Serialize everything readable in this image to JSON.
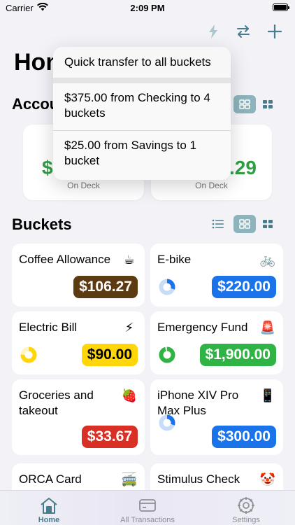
{
  "status": {
    "carrier": "Carrier",
    "time": "2:09 PM"
  },
  "header": {
    "title": "Home"
  },
  "accounts": {
    "title": "Accounts",
    "cards": [
      {
        "amount_visible": "$",
        "caption": "On Deck"
      },
      {
        "amount_visible": ".29",
        "caption": "On Deck"
      }
    ]
  },
  "buckets": {
    "title": "Buckets",
    "items": [
      {
        "name": "Coffee Allowance",
        "icon": "coffee-icon",
        "glyph": "☕",
        "amount": "$106.27",
        "color": "#5c3a12",
        "text_color": "#ffffff",
        "gauge": null
      },
      {
        "name": "E-bike",
        "icon": "bicycle-icon",
        "glyph": "🚲",
        "amount": "$220.00",
        "color": "#1a73e8",
        "text_color": "#ffffff",
        "gauge": 0.3
      },
      {
        "name": "Electric Bill",
        "icon": "lightning-icon",
        "glyph": "⚡",
        "amount": "$90.00",
        "color": "#ffd60a",
        "text_color": "#000000",
        "gauge": 0.75
      },
      {
        "name": "Emergency Fund",
        "icon": "siren-icon",
        "glyph": "🚨",
        "amount": "$1,900.00",
        "color": "#2fb344",
        "text_color": "#ffffff",
        "gauge": 0.95
      },
      {
        "name": "Groceries and takeout",
        "icon": "strawberry-icon",
        "glyph": "🍓",
        "amount": "$33.67",
        "color": "#d93025",
        "text_color": "#ffffff",
        "gauge": null
      },
      {
        "name": "iPhone XIV Pro Max Plus",
        "icon": "phone-icon",
        "glyph": "📱",
        "amount": "$300.00",
        "color": "#1a73e8",
        "text_color": "#ffffff",
        "gauge": 0.3
      },
      {
        "name": "ORCA Card",
        "icon": "trolleybus-icon",
        "glyph": "🚎",
        "amount": "",
        "color": "",
        "text_color": "",
        "gauge": null
      },
      {
        "name": "Stimulus Check",
        "icon": "clown-icon",
        "glyph": "🤡",
        "amount": "",
        "color": "",
        "text_color": "",
        "gauge": null
      }
    ]
  },
  "menu": {
    "header": "Quick transfer to all buckets",
    "items": [
      {
        "label": "$375.00 from Checking to 4 buckets"
      },
      {
        "label": "$25.00 from Savings to 1 bucket"
      }
    ]
  },
  "tabs": [
    {
      "label": "Home",
      "icon": "house-icon"
    },
    {
      "label": "All Transactions",
      "icon": "credit-card-icon"
    },
    {
      "label": "Settings",
      "icon": "gear-icon"
    }
  ],
  "colors": {
    "accent": "#4a7d8c",
    "toggle_selected": "#8db3bd",
    "positive_green": "#2f9e44"
  }
}
